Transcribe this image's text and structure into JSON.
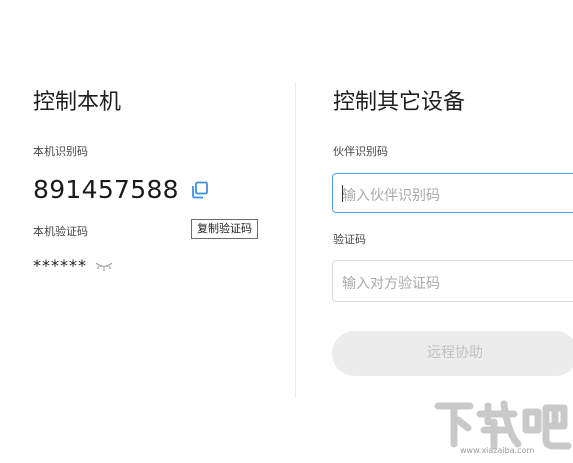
{
  "local": {
    "title": "控制本机",
    "id_label": "本机识别码",
    "device_id": "891457588",
    "verify_label": "本机验证码",
    "copy_tooltip": "复制验证码",
    "masked_code": "******",
    "icons": {
      "copy": "copy-icon",
      "reveal": "eye-closed-icon"
    }
  },
  "remote": {
    "title": "控制其它设备",
    "partner_id_label": "伙伴识别码",
    "partner_id_placeholder": "输入伙伴识别码",
    "partner_id_value": "",
    "verify_label": "验证码",
    "verify_placeholder": "输入对方验证码",
    "verify_value": "",
    "connect_label": "远程协助"
  },
  "watermark": {
    "text": "下载吧",
    "url": "www.xiazaiba.com"
  },
  "colors": {
    "accent": "#5a9fe0",
    "copy_icon": "#3d8fe0",
    "button_bg": "#ececec",
    "button_text": "#c2c2c2",
    "divider": "#ececec",
    "watermark": "#c9c9c9"
  }
}
